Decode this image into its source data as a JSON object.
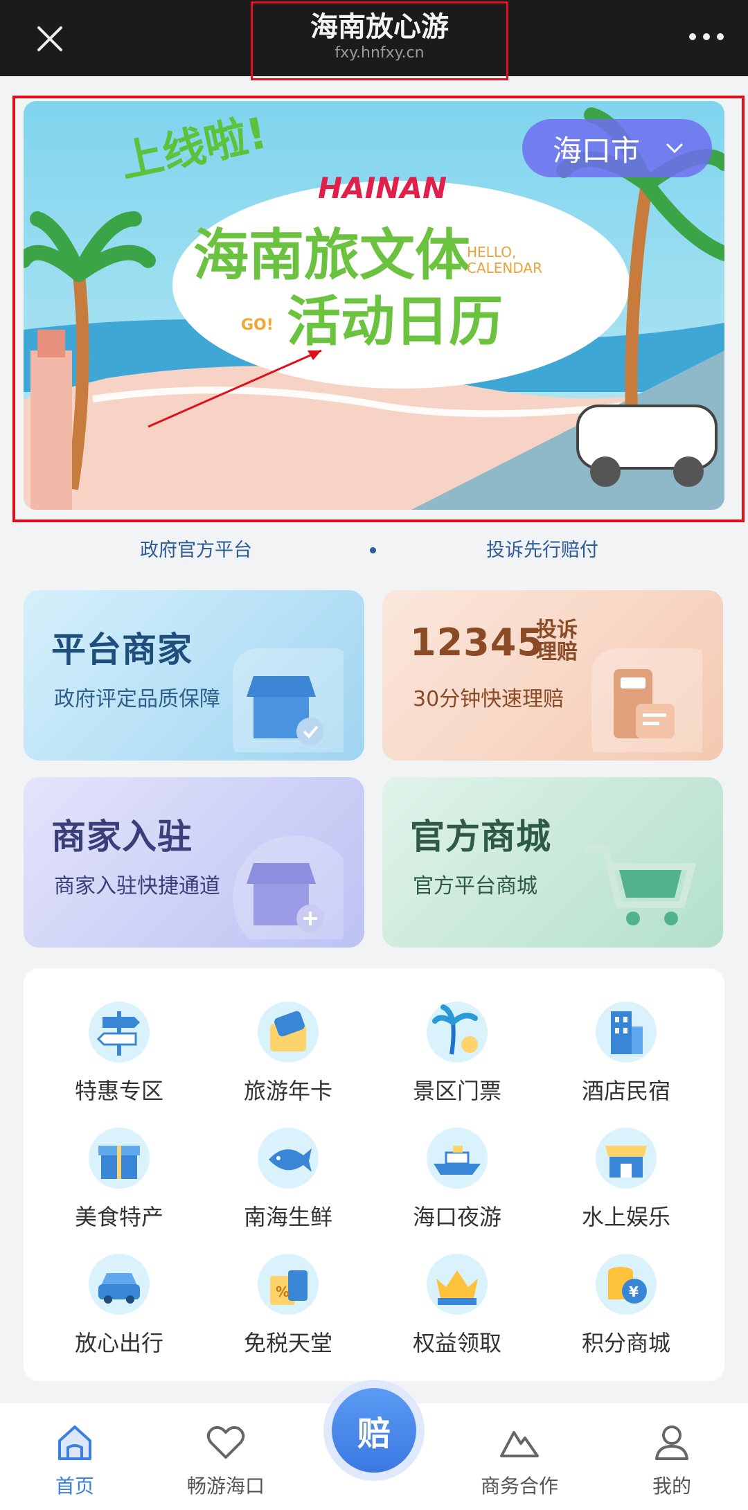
{
  "header": {
    "title": "海南放心游",
    "subtitle": "fxy.hnfxy.cn",
    "close_icon": "close-icon",
    "more_icon": "more-icon"
  },
  "banner": {
    "headline_top": "上线啦!",
    "brand": "HAINAN",
    "main_title": "海南旅文体",
    "secondary_title": "活动日历",
    "hello": "HELLO,",
    "calendar": "CALENDAR",
    "go": "GO!",
    "city": "海口市"
  },
  "promises": {
    "left": "政府官方平台",
    "right": "投诉先行赔付"
  },
  "cards": [
    {
      "title": "平台商家",
      "sub": "政府评定品质保障",
      "icon": "shop-check-icon"
    },
    {
      "title_num": "12345",
      "title_tag_1": "投诉",
      "title_tag_2": "理赔",
      "sub": "30分钟快速理赔",
      "icon": "document-icon"
    },
    {
      "title": "商家入驻",
      "sub": "商家入驻快捷通道",
      "icon": "shop-add-icon"
    },
    {
      "title": "官方商城",
      "sub": "官方平台商城",
      "icon": "cart-icon"
    }
  ],
  "grid": [
    {
      "label": "特惠专区",
      "icon": "signpost-icon"
    },
    {
      "label": "旅游年卡",
      "icon": "card-icon"
    },
    {
      "label": "景区门票",
      "icon": "palm-ticket-icon"
    },
    {
      "label": "酒店民宿",
      "icon": "hotel-icon"
    },
    {
      "label": "美食特产",
      "icon": "gift-icon"
    },
    {
      "label": "南海生鲜",
      "icon": "fish-icon"
    },
    {
      "label": "海口夜游",
      "icon": "ship-icon"
    },
    {
      "label": "水上娱乐",
      "icon": "store-icon"
    },
    {
      "label": "放心出行",
      "icon": "car-icon"
    },
    {
      "label": "免税天堂",
      "icon": "shopping-bag-icon"
    },
    {
      "label": "权益领取",
      "icon": "crown-icon"
    },
    {
      "label": "积分商城",
      "icon": "coins-icon"
    }
  ],
  "nav": {
    "home": "首页",
    "explore": "畅游海口",
    "center": "赔",
    "business": "商务合作",
    "mine": "我的"
  },
  "colors": {
    "accent": "#3a7ee0",
    "topbar": "#1b1b1b",
    "highlight": "#e0101a"
  }
}
